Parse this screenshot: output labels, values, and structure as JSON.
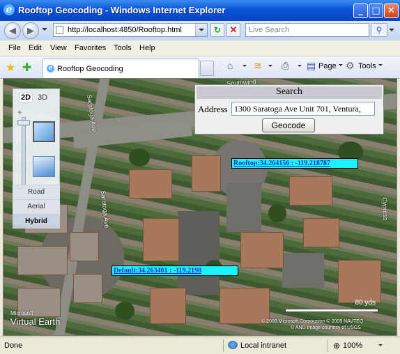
{
  "window": {
    "title": "Rooftop Geocoding - Windows Internet Explorer"
  },
  "address_bar": {
    "url": "http://localhost:4850/Rooftop.html",
    "search_placeholder": "Live Search"
  },
  "menu": [
    "File",
    "Edit",
    "View",
    "Favorites",
    "Tools",
    "Help"
  ],
  "tab": {
    "label": "Rooftop Geocoding"
  },
  "command_bar": {
    "page_label": "Page",
    "tools_label": "Tools"
  },
  "map_controls": {
    "view_2d": "2D",
    "view_3d": "3D",
    "modes": [
      "Road",
      "Aerial",
      "Hybrid"
    ],
    "selected_mode": "Hybrid"
  },
  "street_labels": [
    "Saratoga Ave",
    "Saratoga Ave",
    "Southwind",
    "Cypress"
  ],
  "search_panel": {
    "header": "Search",
    "address_label": "Address",
    "address_value": "1300 Saratoga Ave Unit 701, Ventura,",
    "geocode_button": "Geocode"
  },
  "pins": {
    "rooftop": "Rooftop:34.264156 : -119.218787",
    "default": "Default:34.263401 : -119.2198"
  },
  "scale": {
    "label": "80 yds"
  },
  "attribution": {
    "copyright": "© 2008 Microsoft Corporation  © 2008 NAVTEQ",
    "imagery": "© AND  Image courtesy of USGS",
    "logo_top": "Microsoft",
    "logo_bottom": "Virtual Earth"
  },
  "status_bar": {
    "status": "Done",
    "zone": "Local intranet",
    "zoom": "100%"
  }
}
